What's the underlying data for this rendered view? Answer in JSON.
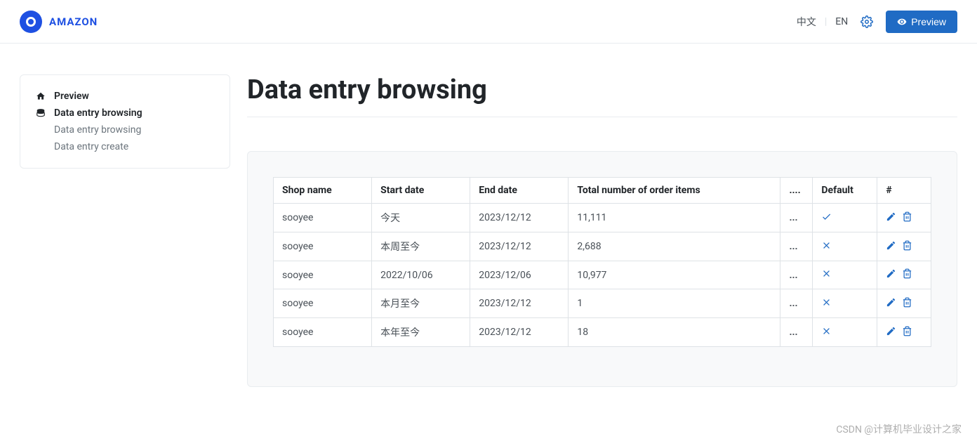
{
  "header": {
    "logo_text": "AMAZON",
    "lang_zh": "中文",
    "lang_en": "EN",
    "preview_btn": "Preview"
  },
  "sidebar": {
    "items": [
      {
        "label": "Preview",
        "icon": "home"
      },
      {
        "label": "Data entry browsing",
        "icon": "database"
      }
    ],
    "subitems": [
      {
        "label": "Data entry browsing"
      },
      {
        "label": "Data entry create"
      }
    ]
  },
  "page": {
    "title": "Data entry browsing"
  },
  "table": {
    "headers": {
      "shop_name": "Shop name",
      "start_date": "Start date",
      "end_date": "End date",
      "total": "Total number of order items",
      "dots": "....",
      "default": "Default",
      "hash": "#"
    },
    "rows": [
      {
        "shop": "sooyee",
        "start": "今天",
        "end": "2023/12/12",
        "total": "11,111",
        "default": true
      },
      {
        "shop": "sooyee",
        "start": "本周至今",
        "end": "2023/12/12",
        "total": "2,688",
        "default": false
      },
      {
        "shop": "sooyee",
        "start": "2022/10/06",
        "end": "2023/12/06",
        "total": "10,977",
        "default": false
      },
      {
        "shop": "sooyee",
        "start": "本月至今",
        "end": "2023/12/12",
        "total": "1",
        "default": false
      },
      {
        "shop": "sooyee",
        "start": "本年至今",
        "end": "2023/12/12",
        "total": "18",
        "default": false
      }
    ]
  },
  "watermark": "CSDN @计算机毕业设计之家"
}
